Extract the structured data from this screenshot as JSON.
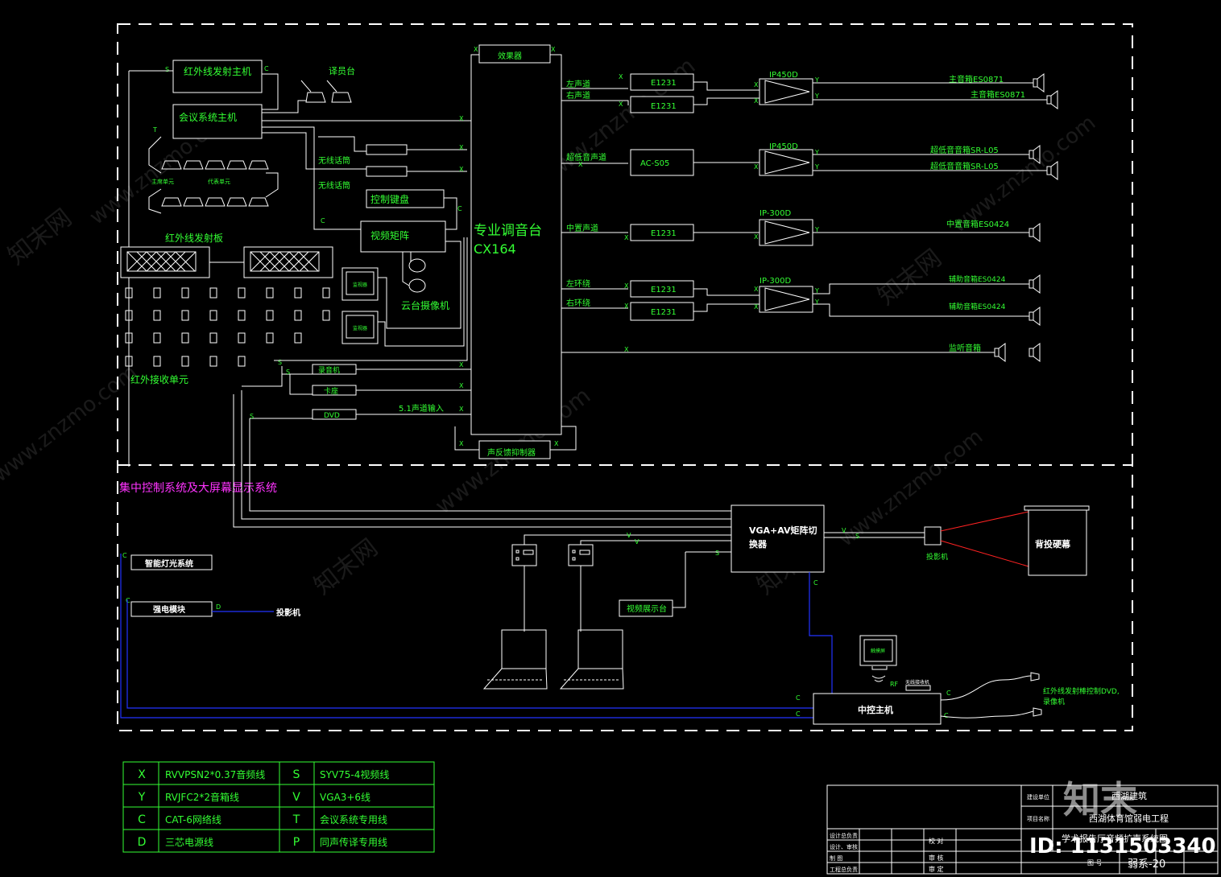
{
  "devices": {
    "ir_host": "红外线发射主机",
    "interpreter": "译员台",
    "conf_host": "会议系统主机",
    "chair_unit": "主席单元",
    "delegate_unit": "代表单元",
    "wireless_mic_1": "无线话筒",
    "wireless_mic_2": "无线话筒",
    "control_keyboard": "控制键盘",
    "video_matrix": "视频矩阵",
    "ptz_camera": "云台摄像机",
    "ir_panel": "红外线发射板",
    "ir_receiver": "红外接收单元",
    "monitor": "监视器",
    "effects": "效果器",
    "mixer": "专业调音台",
    "mixer_model": "CX164",
    "feedback": "声反馈抑制器",
    "recorder": "录音机",
    "cassette": "卡座",
    "dvd": "DVD",
    "dvd_input": "5.1声道输入",
    "ch_left": "左声道",
    "ch_right": "右声道",
    "ch_sub": "超低音声道",
    "ch_center": "中置声道",
    "ch_lsurround": "左环绕",
    "ch_rsurround": "右环绕",
    "eq": "E1231",
    "ac": "AC-S05",
    "amp_1": "IP450D",
    "amp_2": "IP450D",
    "amp_3": "IP-300D",
    "amp_4": "IP-300D",
    "spk_main_1": "主音箱ES0871",
    "spk_main_2": "主音箱ES0871",
    "spk_sub_1": "超低音音箱SR-L05",
    "spk_sub_2": "超低音音箱SR-L05",
    "spk_center": "中置音箱ES0424",
    "spk_aux_1": "辅助音箱ES0424",
    "spk_aux_2": "辅助音箱ES0424",
    "spk_monitor": "监听音箱"
  },
  "section2": {
    "title": "集中控制系统及大屏幕显示系统",
    "lighting": "智能灯光系统",
    "power_module": "强电模块",
    "projector_ref": "投影机",
    "vga_matrix_1": "VGA+AV矩阵切",
    "vga_matrix_2": "换器",
    "video_booth": "视频展示台",
    "projector": "投影机",
    "screen": "背投硬幕",
    "central_host": "中控主机",
    "touch_panel": "触摸屏",
    "rf": "RF",
    "rf_receiver": "无线接收机",
    "ir_note_1": "红外线发射棒控制DVD,",
    "ir_note_2": "录像机"
  },
  "legend": [
    {
      "code": "X",
      "desc": "RVVPSN2*0.37音频线",
      "code2": "S",
      "desc2": "SYV75-4视频线"
    },
    {
      "code": "Y",
      "desc": "RVJFC2*2音箱线",
      "code2": "V",
      "desc2": "VGA3+6线"
    },
    {
      "code": "C",
      "desc": "CAT-6网络线",
      "code2": "T",
      "desc2": "会议系统专用线"
    },
    {
      "code": "D",
      "desc": "三芯电源线",
      "code2": "P",
      "desc2": "同声传译专用线"
    }
  ],
  "titleblock": {
    "company_label": "建设单位",
    "company": "西湖建筑",
    "project_label": "项目名称",
    "project": "西湖体育馆弱电工程",
    "drawing": "学术报告厅音频扩声系统图",
    "design_lead": "设计总负责",
    "design_check": "设计、审核",
    "drafting": "制 图",
    "engineer": "工程总负责",
    "proofread": "校 对",
    "review": "审 核",
    "approve": "审 定",
    "drawing_no_label": "图 号",
    "drawing_no": "弱系-20"
  },
  "watermark": {
    "site": "www.znzmo.com",
    "brand": "知末网",
    "logo": "知末",
    "id": "ID: 1131503340"
  },
  "colors": {
    "line": "#33ff33",
    "wire": "#ffffff",
    "control": "#2233ff",
    "note": "#ff33ff",
    "beam": "#ff2222"
  }
}
